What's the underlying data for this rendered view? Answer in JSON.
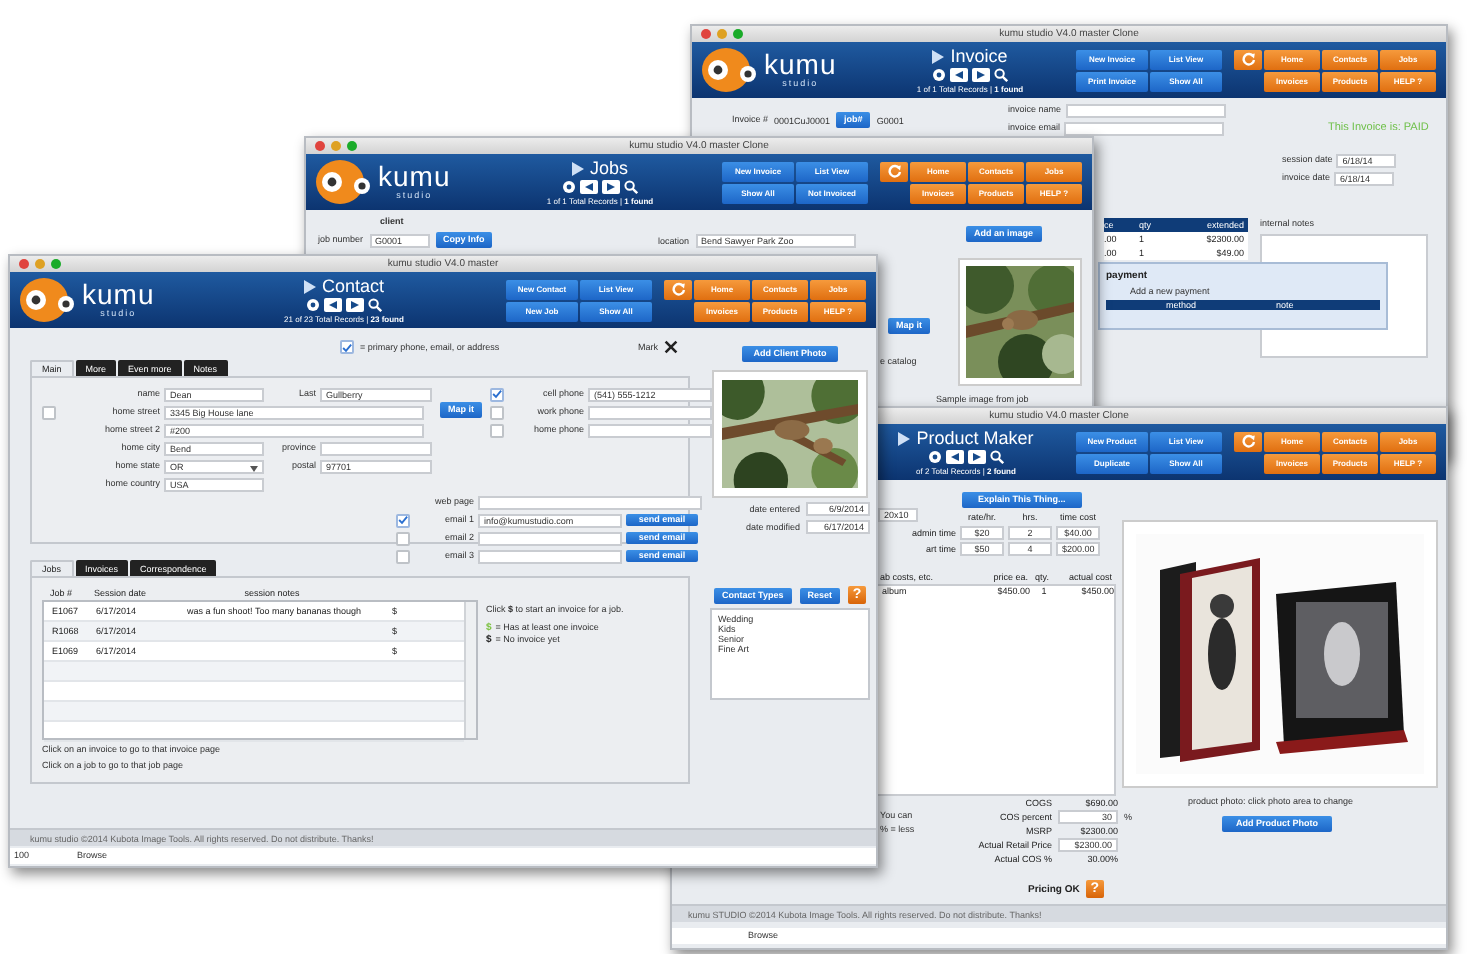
{
  "windows": [
    {
      "kind": "invoice",
      "title": "kumu studio V4.0 master Clone",
      "window_buttons": true,
      "header": {
        "logo": "kumu",
        "logo_sub": "studio",
        "module": "Invoice",
        "records": "1 of 1 Total Records | **1 found**",
        "actions": [
          "New Invoice",
          "List View",
          "Print Invoice",
          "Show All"
        ],
        "nav": [
          "Home",
          "Contacts",
          "Jobs",
          "Invoices",
          "Products",
          "HELP ?"
        ]
      },
      "invoice_number_label": "Invoice #",
      "invoice_number": "0001CuJ0001",
      "job_button": "job#",
      "job_value": "G0001",
      "invoice_name_label": "invoice name",
      "invoice_email_label": "invoice email",
      "status": "This Invoice is: PAID",
      "session_date_label": "session date",
      "session_date": "6/18/14",
      "invoice_date_label": "invoice date",
      "invoice_date": "6/18/14",
      "internal_notes_label": "internal notes",
      "item_columns": [
        "ce",
        "qty",
        "extended"
      ],
      "item_rows": [
        [
          ".00",
          "1",
          "$2300.00"
        ],
        [
          ".00",
          "1",
          "$49.00"
        ]
      ],
      "payment_title": "payment",
      "payment_add": "Add a new payment",
      "payment_columns": [
        "method",
        "note"
      ]
    },
    {
      "kind": "jobs",
      "title": "kumu studio V4.0 master Clone",
      "window_buttons": true,
      "header": {
        "logo": "kumu",
        "logo_sub": "studio",
        "module": "Jobs",
        "records": "1 of 1 Total Records | **1 found**",
        "actions": [
          "New Invoice",
          "List View",
          "Show All",
          "Not Invoiced"
        ],
        "nav": [
          "Home",
          "Contacts",
          "Jobs",
          "Invoices",
          "Products",
          "HELP ?"
        ]
      },
      "client_label": "client",
      "job_number_label": "job number",
      "job_number": "G0001",
      "copy_button": "Copy Info",
      "location_label": "location",
      "location": "Bend Sawyer Park Zoo",
      "image_button": "Add an image",
      "map_button": "Map it",
      "catalog_text": "e catalog",
      "image_caption": "Sample image from job"
    },
    {
      "kind": "product",
      "title": "kumu studio V4.0 master Clone",
      "header": {
        "module": "Product Maker",
        "records": "of 2 Total Records | **2 found**",
        "actions": [
          "New Product",
          "List View",
          "Duplicate",
          "Show All"
        ],
        "nav": [
          "Home",
          "Contacts",
          "Jobs",
          "Invoices",
          "Products",
          "HELP ?"
        ]
      },
      "explain_button": "Explain This Thing...",
      "size": "20x10",
      "time_columns": [
        "rate/hr.",
        "hrs.",
        "time cost"
      ],
      "time_rows": [
        [
          "admin time",
          "$20",
          "2",
          "$40.00"
        ],
        [
          "art time",
          "$50",
          "4",
          "$200.00"
        ]
      ],
      "cost_columns": [
        "ab costs, etc.",
        "price ea.",
        "qty.",
        "actual cost"
      ],
      "cost_rows": [
        [
          "album",
          "$450.00",
          "1",
          "$450.00"
        ]
      ],
      "note_lines": [
        "You can",
        "% = less"
      ],
      "pricing": [
        {
          "kind": "text",
          "label": "COGS",
          "value": "$690.00"
        },
        {
          "kind": "field",
          "label": "COS percent",
          "value": "30",
          "unit": "%"
        },
        {
          "kind": "text",
          "label": "MSRP",
          "value": "$2300.00"
        },
        {
          "kind": "field",
          "label": "Actual Retail Price",
          "value": "$2300.00"
        },
        {
          "kind": "text",
          "label": "Actual COS %",
          "value": "30.00%"
        }
      ],
      "pricing_status": "Pricing OK",
      "help_button": "?",
      "photo_caption": "product photo: click photo area to change",
      "photo_button": "Add Product Photo",
      "footer": "kumu STUDIO ©2014 Kubota Image Tools. All rights reserved. Do not distribute. Thanks!",
      "status_mode": "Browse"
    },
    {
      "kind": "contact",
      "title": "kumu studio V4.0 master",
      "window_buttons": true,
      "header": {
        "logo": "kumu",
        "logo_sub": "studio",
        "module": "Contact",
        "records": "21 of 23 Total Records | **23 found**",
        "actions": [
          "New Contact",
          "List View",
          "New Job",
          "Show All"
        ],
        "nav": [
          "Home",
          "Contacts",
          "Jobs",
          "Invoices",
          "Products",
          "HELP ?"
        ]
      },
      "primary_legend": "= primary phone, email, or address",
      "mark_label": "Mark",
      "tabs": [
        {
          "label": "Main",
          "selected": true
        },
        {
          "label": "More",
          "selected": false
        },
        {
          "label": "Even more",
          "selected": false
        },
        {
          "label": "Notes",
          "selected": false
        }
      ],
      "name_label": "name",
      "first_name": "Dean",
      "last_label": "Last",
      "last_name": "Gullberry",
      "street_checked": false,
      "street_label": "home street",
      "street": "3345 Big House lane",
      "street2_label": "home street 2",
      "street2": "#200",
      "city_label": "home city",
      "city": "Bend",
      "province_label": "province",
      "state_label": "home state",
      "state": "OR",
      "postal_label": "postal",
      "postal": "97701",
      "country_label": "home country",
      "country": "USA",
      "map_button": "Map it",
      "phones": [
        {
          "label": "cell phone",
          "value": "(541) 555-1212",
          "checked": true
        },
        {
          "label": "work phone",
          "checked": false
        },
        {
          "label": "home phone",
          "checked": false
        }
      ],
      "web_label": "web page",
      "emails": [
        {
          "label": "email 1",
          "value": "info@kumustudio.com",
          "checked": true,
          "button": "send email"
        },
        {
          "label": "email 2",
          "checked": false,
          "button": "send email"
        },
        {
          "label": "email 3",
          "checked": false,
          "button": "send email"
        }
      ],
      "photo_button": "Add Client Photo",
      "date_entered_label": "date entered",
      "date_entered": "6/9/2014",
      "date_modified_label": "date modified",
      "date_modified": "6/17/2014",
      "job_tabs": [
        {
          "label": "Jobs",
          "selected": true
        },
        {
          "label": "Invoices",
          "selected": false
        },
        {
          "label": "Correspondence",
          "selected": false
        }
      ],
      "job_columns": [
        "Job #",
        "Session date",
        "session notes"
      ],
      "jobs": [
        {
          "number": "E1067",
          "date": "6/17/2014",
          "notes": "was a fun shoot! Too many bananas though",
          "dollar": "$"
        },
        {
          "number": "R1068",
          "date": "6/17/2014",
          "dollar": "$"
        },
        {
          "number": "E1069",
          "date": "6/17/2014",
          "dollar": "$"
        }
      ],
      "invoice_hint": "Click **$** to start an invoice for a job.",
      "legend": [
        {
          "symbol": "$",
          "color": "#7cc242",
          "text": "= Has at least one invoice"
        },
        {
          "symbol": "$",
          "color": "#222222",
          "text": "= No invoice yet"
        }
      ],
      "instructions": [
        "Click on an invoice to go to that invoice page",
        "Click on a job to go to that job page"
      ],
      "types_button": "Contact Types",
      "reset_button": "Reset",
      "help_button": "?",
      "contact_types": [
        "Wedding",
        "Kids",
        "Senior",
        "Fine Art"
      ],
      "footer": "kumu studio ©2014 Kubota Image Tools. All rights reserved. Do not distribute. Thanks!",
      "zoom": "100",
      "status_mode": "Browse"
    }
  ]
}
